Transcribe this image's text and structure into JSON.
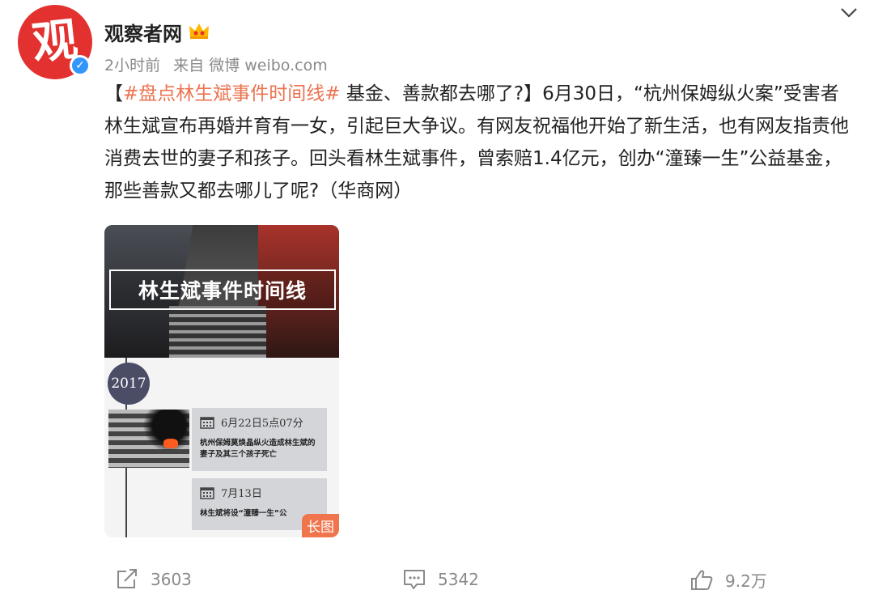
{
  "account": {
    "name": "观察者网",
    "avatar_char": "观",
    "time": "2小时前",
    "source": "来自 微博 weibo.com"
  },
  "post": {
    "prefix": "【",
    "hashtag": "#盘点林生斌事件时间线#",
    "body": " 基金、善款都去哪了?】6月30日，“杭州保姆纵火案”受害者林生斌宣布再婚并育有一女，引起巨大争议。有网友祝福他开始了新生活，也有网友指责他消费去世的妻子和孩子。回头看林生斌事件，曾索赔1.4亿元，创办“潼臻一生”公益基金，那些善款又都去哪儿了呢?（华商网）"
  },
  "image_card": {
    "title": "林生斌事件时间线",
    "year": "2017",
    "events": [
      {
        "date": "6月22日5点07分",
        "desc": "杭州保姆莫焕晶纵火造成林生斌的妻子及其三个孩子死亡"
      },
      {
        "date": "7月13日",
        "desc": "林生斌将设“潼臻一生”公"
      }
    ],
    "badge": "长图"
  },
  "actions": {
    "share_count": "3603",
    "comment_count": "5342",
    "like_count": "9.2万"
  },
  "colors": {
    "hashtag": "#eb7350",
    "avatar_bg": "#e2312f",
    "verify": "#3296fa",
    "badge": "#f0754d"
  }
}
